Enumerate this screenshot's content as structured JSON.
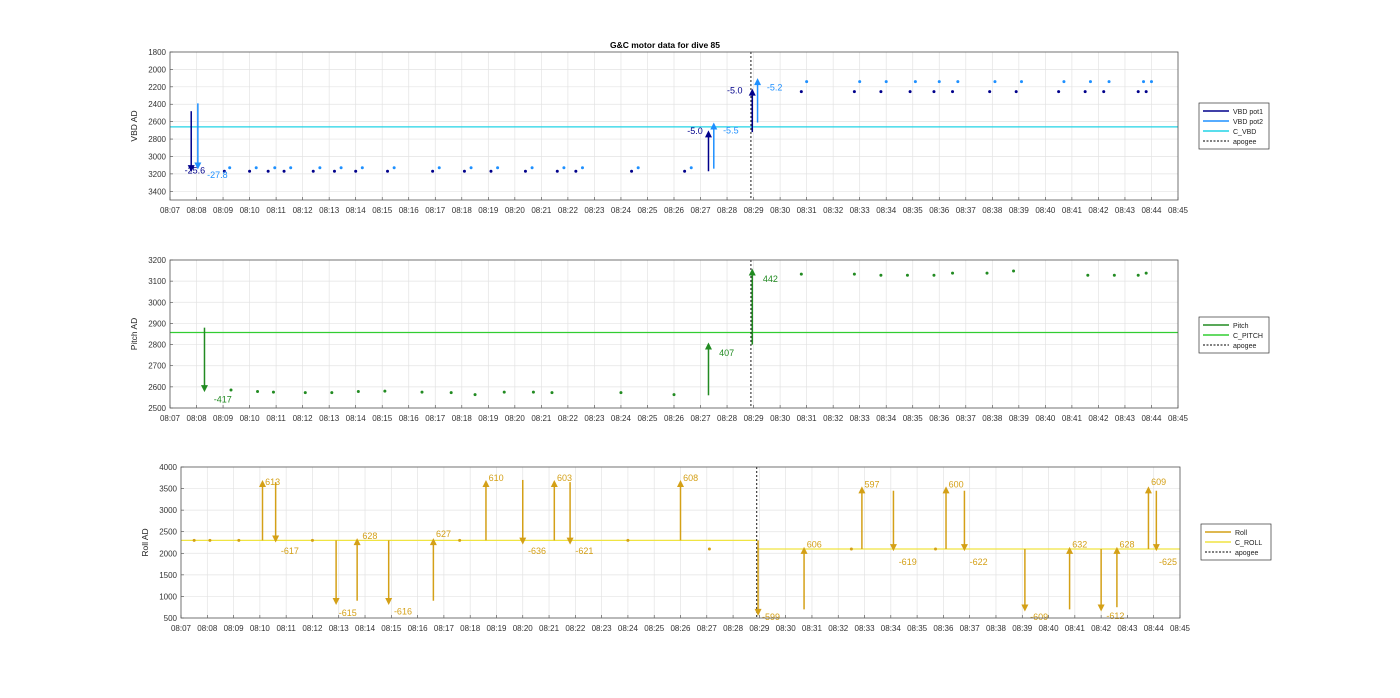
{
  "figure": {
    "title": "G&C motor data for dive 85"
  },
  "chart_data": [
    {
      "id": "vbd",
      "type": "scatter",
      "title": "G&C motor data for dive 85",
      "ylabel": "VBD AD",
      "xlabel": "",
      "x_axis": "time (HH:MM)",
      "xticks": [
        "08:07",
        "08:08",
        "08:09",
        "08:10",
        "08:11",
        "08:12",
        "08:13",
        "08:14",
        "08:15",
        "08:16",
        "08:17",
        "08:18",
        "08:19",
        "08:20",
        "08:21",
        "08:22",
        "08:23",
        "08:24",
        "08:25",
        "08:26",
        "08:27",
        "08:28",
        "08:29",
        "08:30",
        "08:31",
        "08:32",
        "08:33",
        "08:34",
        "08:35",
        "08:36",
        "08:37",
        "08:38",
        "08:39",
        "08:40",
        "08:41",
        "08:42",
        "08:43",
        "08:44",
        "08:45"
      ],
      "xlim": [
        0,
        38
      ],
      "ylim": [
        3500,
        1800
      ],
      "y_reversed": true,
      "yticks": [
        1800,
        2000,
        2200,
        2400,
        2600,
        2800,
        3000,
        3200,
        3400
      ],
      "grid": true,
      "legend_position": "right",
      "legend": [
        {
          "label": "VBD pot1",
          "color": "#00008b",
          "style": "solid"
        },
        {
          "label": "VBD pot2",
          "color": "#1e90ff",
          "style": "solid"
        },
        {
          "label": "C_VBD",
          "color": "#22d3e6",
          "style": "solid"
        },
        {
          "label": "apogee",
          "color": "#000000",
          "style": "dotted"
        }
      ],
      "reference_lines": [
        {
          "name": "C_VBD",
          "y": 2660,
          "color": "#22d3e6"
        }
      ],
      "apogee_x": 21.9,
      "series": [
        {
          "name": "VBD pot1",
          "color": "#00008b",
          "x": [
            2.05,
            3.0,
            3.7,
            4.3,
            5.4,
            6.2,
            7.0,
            8.2,
            9.9,
            11.1,
            12.1,
            13.4,
            14.6,
            15.3,
            17.4,
            19.4
          ],
          "y": [
            3170,
            3170,
            3170,
            3170,
            3170,
            3170,
            3170,
            3170,
            3170,
            3170,
            3170,
            3170,
            3170,
            3170,
            3170,
            3170
          ]
        },
        {
          "name": "VBD pot2",
          "color": "#1e90ff",
          "x": [
            2.25,
            3.25,
            3.95,
            4.55,
            5.65,
            6.45,
            7.25,
            8.45,
            10.15,
            11.35,
            12.35,
            13.65,
            14.85,
            15.55,
            17.65,
            19.65
          ],
          "y": [
            3130,
            3130,
            3130,
            3130,
            3130,
            3130,
            3130,
            3130,
            3130,
            3130,
            3130,
            3130,
            3130,
            3130,
            3130,
            3130
          ]
        },
        {
          "name": "VBD pot1 (after apogee)",
          "color": "#00008b",
          "x": [
            23.8,
            25.8,
            26.8,
            27.9,
            28.8,
            29.5,
            30.9,
            31.9,
            33.5,
            34.5,
            35.2,
            36.5,
            36.8
          ],
          "y": [
            2255,
            2255,
            2255,
            2255,
            2255,
            2255,
            2255,
            2255,
            2255,
            2255,
            2255,
            2255,
            2255
          ]
        },
        {
          "name": "VBD pot2 (after apogee)",
          "color": "#1e90ff",
          "x": [
            24.0,
            26.0,
            27.0,
            28.1,
            29.0,
            29.7,
            31.1,
            32.1,
            33.7,
            34.7,
            35.4,
            36.7,
            37.0
          ],
          "y": [
            2140,
            2140,
            2140,
            2140,
            2140,
            2140,
            2140,
            2140,
            2140,
            2140,
            2140,
            2140,
            2140
          ]
        }
      ],
      "arrows": [
        {
          "x": 0.8,
          "y_from": 2480,
          "y_to": 3180,
          "color": "#00008b",
          "label": "-25.6",
          "lx": 0.55,
          "ly": 3160
        },
        {
          "x": 1.05,
          "y_from": 2390,
          "y_to": 3150,
          "color": "#1e90ff",
          "label": "-27.8",
          "lx": 1.4,
          "ly": 3210
        },
        {
          "x": 20.3,
          "y_from": 3170,
          "y_to": 2700,
          "color": "#00008b",
          "label": "-5.0",
          "lx": 19.5,
          "ly": 2710
        },
        {
          "x": 20.5,
          "y_from": 3140,
          "y_to": 2610,
          "color": "#1e90ff",
          "label": "-5.5",
          "lx": 20.85,
          "ly": 2700
        },
        {
          "x": 21.95,
          "y_from": 2720,
          "y_to": 2220,
          "color": "#00008b",
          "label": "-5.0",
          "lx": 21.0,
          "ly": 2240
        },
        {
          "x": 22.15,
          "y_from": 2610,
          "y_to": 2100,
          "color": "#1e90ff",
          "label": "-5.2",
          "lx": 22.5,
          "ly": 2210
        }
      ]
    },
    {
      "id": "pitch",
      "type": "scatter",
      "ylabel": "Pitch AD",
      "xlabel": "",
      "xticks": [
        "08:07",
        "08:08",
        "08:09",
        "08:10",
        "08:11",
        "08:12",
        "08:13",
        "08:14",
        "08:15",
        "08:16",
        "08:17",
        "08:18",
        "08:19",
        "08:20",
        "08:21",
        "08:22",
        "08:23",
        "08:24",
        "08:25",
        "08:26",
        "08:27",
        "08:28",
        "08:29",
        "08:30",
        "08:31",
        "08:32",
        "08:33",
        "08:34",
        "08:35",
        "08:36",
        "08:37",
        "08:38",
        "08:39",
        "08:40",
        "08:41",
        "08:42",
        "08:43",
        "08:44",
        "08:45"
      ],
      "xlim": [
        0,
        38
      ],
      "ylim": [
        2500,
        3200
      ],
      "y_reversed": false,
      "yticks": [
        2500,
        2600,
        2700,
        2800,
        2900,
        3000,
        3100,
        3200
      ],
      "grid": true,
      "legend_position": "right",
      "legend": [
        {
          "label": "Pitch",
          "color": "#228b22",
          "style": "solid"
        },
        {
          "label": "C_PITCH",
          "color": "#32cd32",
          "style": "solid"
        },
        {
          "label": "apogee",
          "color": "#000000",
          "style": "dotted"
        }
      ],
      "reference_lines": [
        {
          "name": "C_PITCH",
          "y": 2857,
          "color": "#32cd32"
        }
      ],
      "apogee_x": 21.9,
      "series": [
        {
          "name": "Pitch",
          "color": "#228b22",
          "x": [
            2.3,
            3.3,
            3.9,
            5.1,
            6.1,
            7.1,
            8.1,
            9.5,
            10.6,
            11.5,
            12.6,
            13.7,
            14.4,
            17.0,
            19.0,
            23.8,
            25.8,
            26.8,
            27.8,
            28.8,
            29.5,
            30.8,
            31.8,
            34.6,
            35.6,
            36.5,
            36.8
          ],
          "y": [
            2585,
            2578,
            2575,
            2573,
            2573,
            2578,
            2580,
            2575,
            2573,
            2563,
            2575,
            2575,
            2573,
            2573,
            2563,
            3133,
            3133,
            3128,
            3128,
            3128,
            3138,
            3138,
            3148,
            3128,
            3128,
            3128,
            3138
          ]
        }
      ],
      "arrows": [
        {
          "x": 1.3,
          "y_from": 2880,
          "y_to": 2575,
          "color": "#228b22",
          "label": "-417",
          "lx": 1.65,
          "ly": 2540
        },
        {
          "x": 20.3,
          "y_from": 2560,
          "y_to": 2810,
          "color": "#228b22",
          "label": "407",
          "lx": 20.7,
          "ly": 2760
        },
        {
          "x": 21.95,
          "y_from": 2800,
          "y_to": 3160,
          "color": "#228b22",
          "label": "442",
          "lx": 22.35,
          "ly": 3110
        }
      ]
    },
    {
      "id": "roll",
      "type": "scatter",
      "ylabel": "Roll AD",
      "xlabel": "",
      "xticks": [
        "08:07",
        "08:08",
        "08:09",
        "08:10",
        "08:11",
        "08:12",
        "08:13",
        "08:14",
        "08:15",
        "08:16",
        "08:17",
        "08:18",
        "08:19",
        "08:20",
        "08:21",
        "08:22",
        "08:23",
        "08:24",
        "08:25",
        "08:26",
        "08:27",
        "08:28",
        "08:29",
        "08:30",
        "08:31",
        "08:32",
        "08:33",
        "08:34",
        "08:35",
        "08:36",
        "08:37",
        "08:38",
        "08:39",
        "08:40",
        "08:41",
        "08:42",
        "08:43",
        "08:44",
        "08:45"
      ],
      "xlim": [
        0,
        38
      ],
      "ylim": [
        500,
        4000
      ],
      "y_reversed": false,
      "yticks": [
        500,
        1000,
        1500,
        2000,
        2500,
        3000,
        3500,
        4000
      ],
      "grid": true,
      "legend_position": "right",
      "legend": [
        {
          "label": "Roll",
          "color": "#d4a017",
          "style": "solid"
        },
        {
          "label": "C_ROLL",
          "color": "#f0e442",
          "style": "solid"
        },
        {
          "label": "apogee",
          "color": "#000000",
          "style": "dotted"
        }
      ],
      "reference_lines": [
        {
          "name": "C_ROLL before apogee",
          "y": 2300,
          "x_from": 0,
          "x_to": 21.9,
          "color": "#f0e442"
        },
        {
          "name": "C_ROLL after apogee",
          "y": 2100,
          "x_from": 21.9,
          "x_to": 38,
          "color": "#f0e442"
        }
      ],
      "apogee_x": 21.9,
      "series": [
        {
          "name": "Roll",
          "color": "#d4a017",
          "x": [
            0.5,
            1.1,
            2.2,
            5.0,
            10.6,
            17.0,
            20.1,
            25.5,
            28.7
          ],
          "y": [
            2300,
            2300,
            2300,
            2300,
            2300,
            2300,
            2100,
            2100,
            2100
          ]
        }
      ],
      "arrows": [
        {
          "x": 3.1,
          "y_from": 2300,
          "y_to": 3700,
          "label": "613",
          "lx": 3.2,
          "ly": 3650
        },
        {
          "x": 3.6,
          "y_from": 3650,
          "y_to": 2250,
          "label": "-617",
          "lx": 3.8,
          "ly": 2050
        },
        {
          "x": 5.9,
          "y_from": 2300,
          "y_to": 800,
          "label": "-615",
          "lx": 6.0,
          "ly": 620
        },
        {
          "x": 6.7,
          "y_from": 900,
          "y_to": 2350,
          "label": "628",
          "lx": 6.9,
          "ly": 2400
        },
        {
          "x": 7.9,
          "y_from": 2300,
          "y_to": 800,
          "label": "-616",
          "lx": 8.1,
          "ly": 650
        },
        {
          "x": 9.6,
          "y_from": 900,
          "y_to": 2350,
          "label": "627",
          "lx": 9.7,
          "ly": 2450
        },
        {
          "x": 11.6,
          "y_from": 2300,
          "y_to": 3700,
          "label": "610",
          "lx": 11.7,
          "ly": 3750
        },
        {
          "x": 13.0,
          "y_from": 3700,
          "y_to": 2200,
          "label": "-636",
          "lx": 13.2,
          "ly": 2050
        },
        {
          "x": 14.2,
          "y_from": 2300,
          "y_to": 3700,
          "label": "603",
          "lx": 14.3,
          "ly": 3750
        },
        {
          "x": 14.8,
          "y_from": 3650,
          "y_to": 2200,
          "label": "-621",
          "lx": 15.0,
          "ly": 2050
        },
        {
          "x": 19.0,
          "y_from": 2300,
          "y_to": 3700,
          "label": "608",
          "lx": 19.1,
          "ly": 3750
        },
        {
          "x": 21.95,
          "y_from": 2300,
          "y_to": 550,
          "label": "-599",
          "lx": 22.1,
          "ly": 520
        },
        {
          "x": 23.7,
          "y_from": 700,
          "y_to": 2150,
          "label": "606",
          "lx": 23.8,
          "ly": 2200
        },
        {
          "x": 25.9,
          "y_from": 2100,
          "y_to": 3550,
          "label": "597",
          "lx": 26.0,
          "ly": 3600
        },
        {
          "x": 27.1,
          "y_from": 3450,
          "y_to": 2050,
          "label": "-619",
          "lx": 27.3,
          "ly": 1800
        },
        {
          "x": 29.1,
          "y_from": 2100,
          "y_to": 3550,
          "label": "600",
          "lx": 29.2,
          "ly": 3600
        },
        {
          "x": 29.8,
          "y_from": 3450,
          "y_to": 2050,
          "label": "-622",
          "lx": 30.0,
          "ly": 1800
        },
        {
          "x": 32.1,
          "y_from": 2100,
          "y_to": 650,
          "label": "-609",
          "lx": 32.3,
          "ly": 520
        },
        {
          "x": 33.8,
          "y_from": 700,
          "y_to": 2150,
          "label": "632",
          "lx": 33.9,
          "ly": 2200
        },
        {
          "x": 35.0,
          "y_from": 2100,
          "y_to": 650,
          "label": "-612",
          "lx": 35.2,
          "ly": 550
        },
        {
          "x": 35.6,
          "y_from": 750,
          "y_to": 2150,
          "label": "628",
          "lx": 35.7,
          "ly": 2200
        },
        {
          "x": 36.8,
          "y_from": 2100,
          "y_to": 3550,
          "label": "609",
          "lx": 36.9,
          "ly": 3650
        },
        {
          "x": 37.1,
          "y_from": 3450,
          "y_to": 2050,
          "label": "-625",
          "lx": 37.2,
          "ly": 1800
        }
      ]
    }
  ]
}
